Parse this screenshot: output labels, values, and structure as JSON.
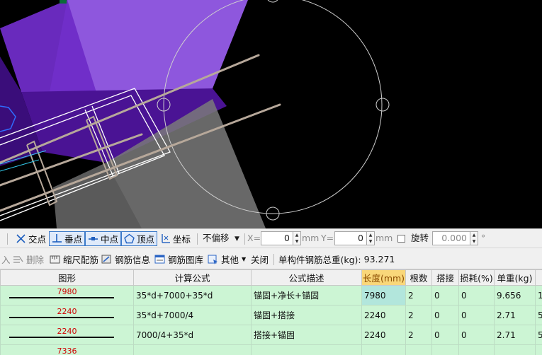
{
  "snap_toolbar": {
    "intersection_label": "交点",
    "perpendicular_label": "垂点",
    "midpoint_label": "中点",
    "vertex_label": "顶点",
    "coordinate_label": "坐标",
    "offset_mode": "不偏移",
    "x_label": "X=",
    "x_value": "0",
    "x_unit": "mm",
    "y_label": "Y=",
    "y_value": "0",
    "y_unit": "mm",
    "rotate_label": "旋转",
    "rotate_value": "0.000",
    "degree_symbol": "°"
  },
  "rebar_toolbar": {
    "insert_label": "入",
    "delete_label": "删除",
    "scale_label": "缩尺配筋",
    "info_label": "钢筋信息",
    "library_label": "钢筋图库",
    "other_label": "其他",
    "close_label": "关闭",
    "total_weight_label": "单构件钢筋总重(kg):",
    "total_weight_value": "93.271"
  },
  "table": {
    "columns": [
      "图形",
      "计算公式",
      "公式描述",
      "长度(mm)",
      "根数",
      "搭接",
      "损耗(%)",
      "单重(kg)"
    ],
    "highlight_column": "长度(mm)",
    "rows": [
      {
        "shape_value": "7980",
        "formula": "35*d+7000+35*d",
        "description": "锚固+净长+锚固",
        "length": "7980",
        "count": "2",
        "lap": "0",
        "loss": "0",
        "unit_weight": "9.656",
        "overflow": "1"
      },
      {
        "shape_value": "2240",
        "formula": "35*d+7000/4",
        "description": "锚固+搭接",
        "length": "2240",
        "count": "2",
        "lap": "0",
        "loss": "0",
        "unit_weight": "2.71",
        "overflow": "5"
      },
      {
        "shape_value": "2240",
        "formula": "7000/4+35*d",
        "description": "搭接+锚固",
        "length": "2240",
        "count": "2",
        "lap": "0",
        "loss": "0",
        "unit_weight": "2.71",
        "overflow": "5"
      },
      {
        "shape_value": "7336",
        "formula": "",
        "description": "",
        "length": "",
        "count": "",
        "lap": "",
        "loss": "",
        "unit_weight": "",
        "overflow": ""
      }
    ]
  },
  "colors": {
    "viewport_bg": "#000000",
    "slab_purple": "#7a3fd0",
    "table_row_bg": "#ccf5d4",
    "highlight_header": "#f9d77a",
    "active_button_border": "#3b79c8"
  }
}
